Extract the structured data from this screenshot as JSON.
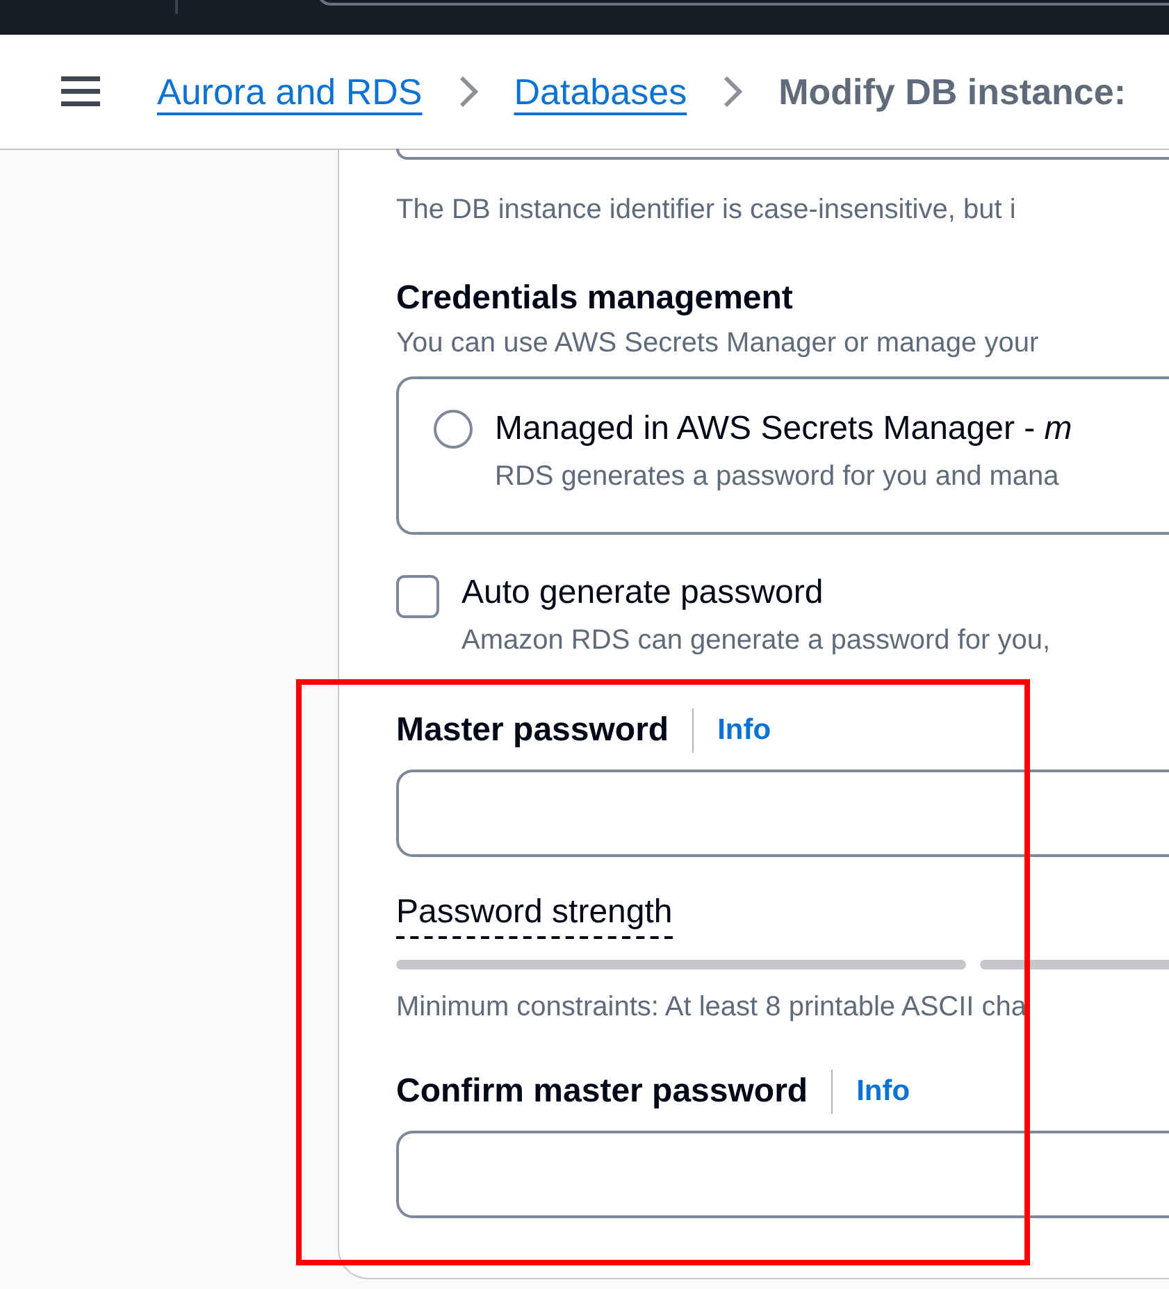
{
  "breadcrumbs": [
    {
      "label": "Aurora and RDS",
      "kind": "link"
    },
    {
      "label": "Databases",
      "kind": "link"
    },
    {
      "label": "Modify DB instance:",
      "kind": "current"
    }
  ],
  "identifier_hint": "The DB instance identifier is case-insensitive, but i",
  "credentials": {
    "title": "Credentials management",
    "description": "You can use AWS Secrets Manager or manage your",
    "options": [
      {
        "label": "Managed in AWS Secrets Manager - *m*",
        "description": "RDS generates a password for you and mana",
        "selected": false
      }
    ]
  },
  "auto_generate": {
    "label": "Auto generate password",
    "description": "Amazon RDS can generate a password for you,",
    "checked": false
  },
  "master_password": {
    "label": "Master password",
    "info": "Info"
  },
  "password_strength": {
    "label": "Password strength",
    "level": 0,
    "constraints": "Minimum constraints: At least 8 printable ASCII cha"
  },
  "confirm_password": {
    "label": "Confirm master password",
    "info": "Info"
  }
}
